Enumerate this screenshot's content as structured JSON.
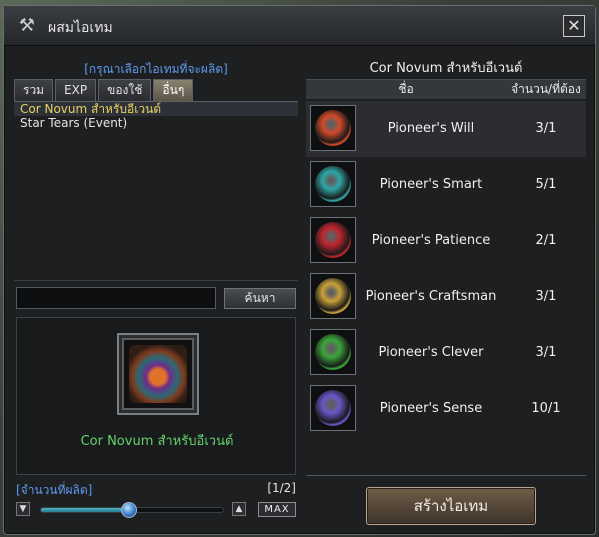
{
  "window": {
    "title": "ผสมไอเทม",
    "close_glyph": "✕",
    "title_icon": "hammer-icon"
  },
  "left": {
    "prompt": "[กรุณาเลือกไอเทมที่จะผลิต]",
    "tabs": [
      "รวม",
      "EXP",
      "ของใช้",
      "อื่นๆ"
    ],
    "active_tab": 3,
    "items": [
      "Cor Novum สำหรับอีเวนต์",
      "Star Tears (Event)"
    ],
    "search": {
      "value": "",
      "button": "ค้นหา"
    },
    "preview_name": "Cor Novum สำหรับอีเวนต์",
    "quantity": {
      "label": "[จำนวนที่ผลิต]",
      "page": "[1/2]",
      "slider_fraction": 0.48,
      "max_label": "MAX",
      "down": "▼",
      "up": "▲"
    }
  },
  "right": {
    "title": "Cor Novum สำหรับอีเวนต์",
    "headers": {
      "name": "ชื่อ",
      "qty": "จำนวน/ที่ต้อง"
    },
    "materials": [
      {
        "name": "Pioneer's Will",
        "qty": "3/1",
        "color": "#d24a2a",
        "icon": "will-coin-icon"
      },
      {
        "name": "Pioneer's Smart",
        "qty": "5/1",
        "color": "#2fa6a6",
        "icon": "smart-coin-icon"
      },
      {
        "name": "Pioneer's Patience",
        "qty": "2/1",
        "color": "#c0252f",
        "icon": "patience-coin-icon"
      },
      {
        "name": "Pioneer's Craftsman",
        "qty": "3/1",
        "color": "#c9a13a",
        "icon": "craftsman-coin-icon"
      },
      {
        "name": "Pioneer's Clever",
        "qty": "3/1",
        "color": "#3aa63a",
        "icon": "clever-coin-icon"
      },
      {
        "name": "Pioneer's Sense",
        "qty": "10/1",
        "color": "#6a55c8",
        "icon": "sense-coin-icon"
      }
    ],
    "create_button": "สร้างไอเทม"
  },
  "colors": {
    "accent_blue": "#5f9bf0",
    "selected_yellow": "#e8d060",
    "preview_green": "#64d46b"
  }
}
